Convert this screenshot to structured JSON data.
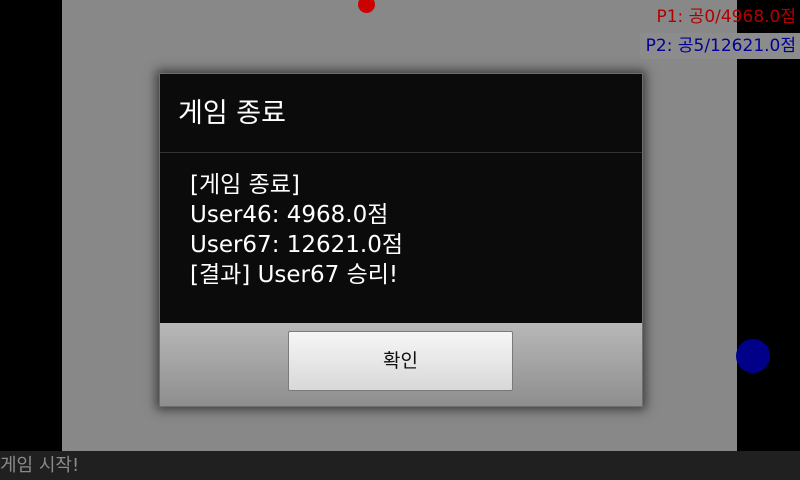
{
  "scoreboard": {
    "p1": "P1: 공0/4968.0점",
    "p2": "P2: 공5/12621.0점"
  },
  "status": "게임 시작!",
  "dialog": {
    "title": "게임 종료",
    "message_lines": [
      "[게임 종료]",
      "User46: 4968.0점",
      "User67: 12621.0점",
      "[결과] User67 승리!"
    ],
    "confirm_label": "확인"
  },
  "colors": {
    "player1": "#b00000",
    "player2": "#000099",
    "playfield": "#888888"
  }
}
